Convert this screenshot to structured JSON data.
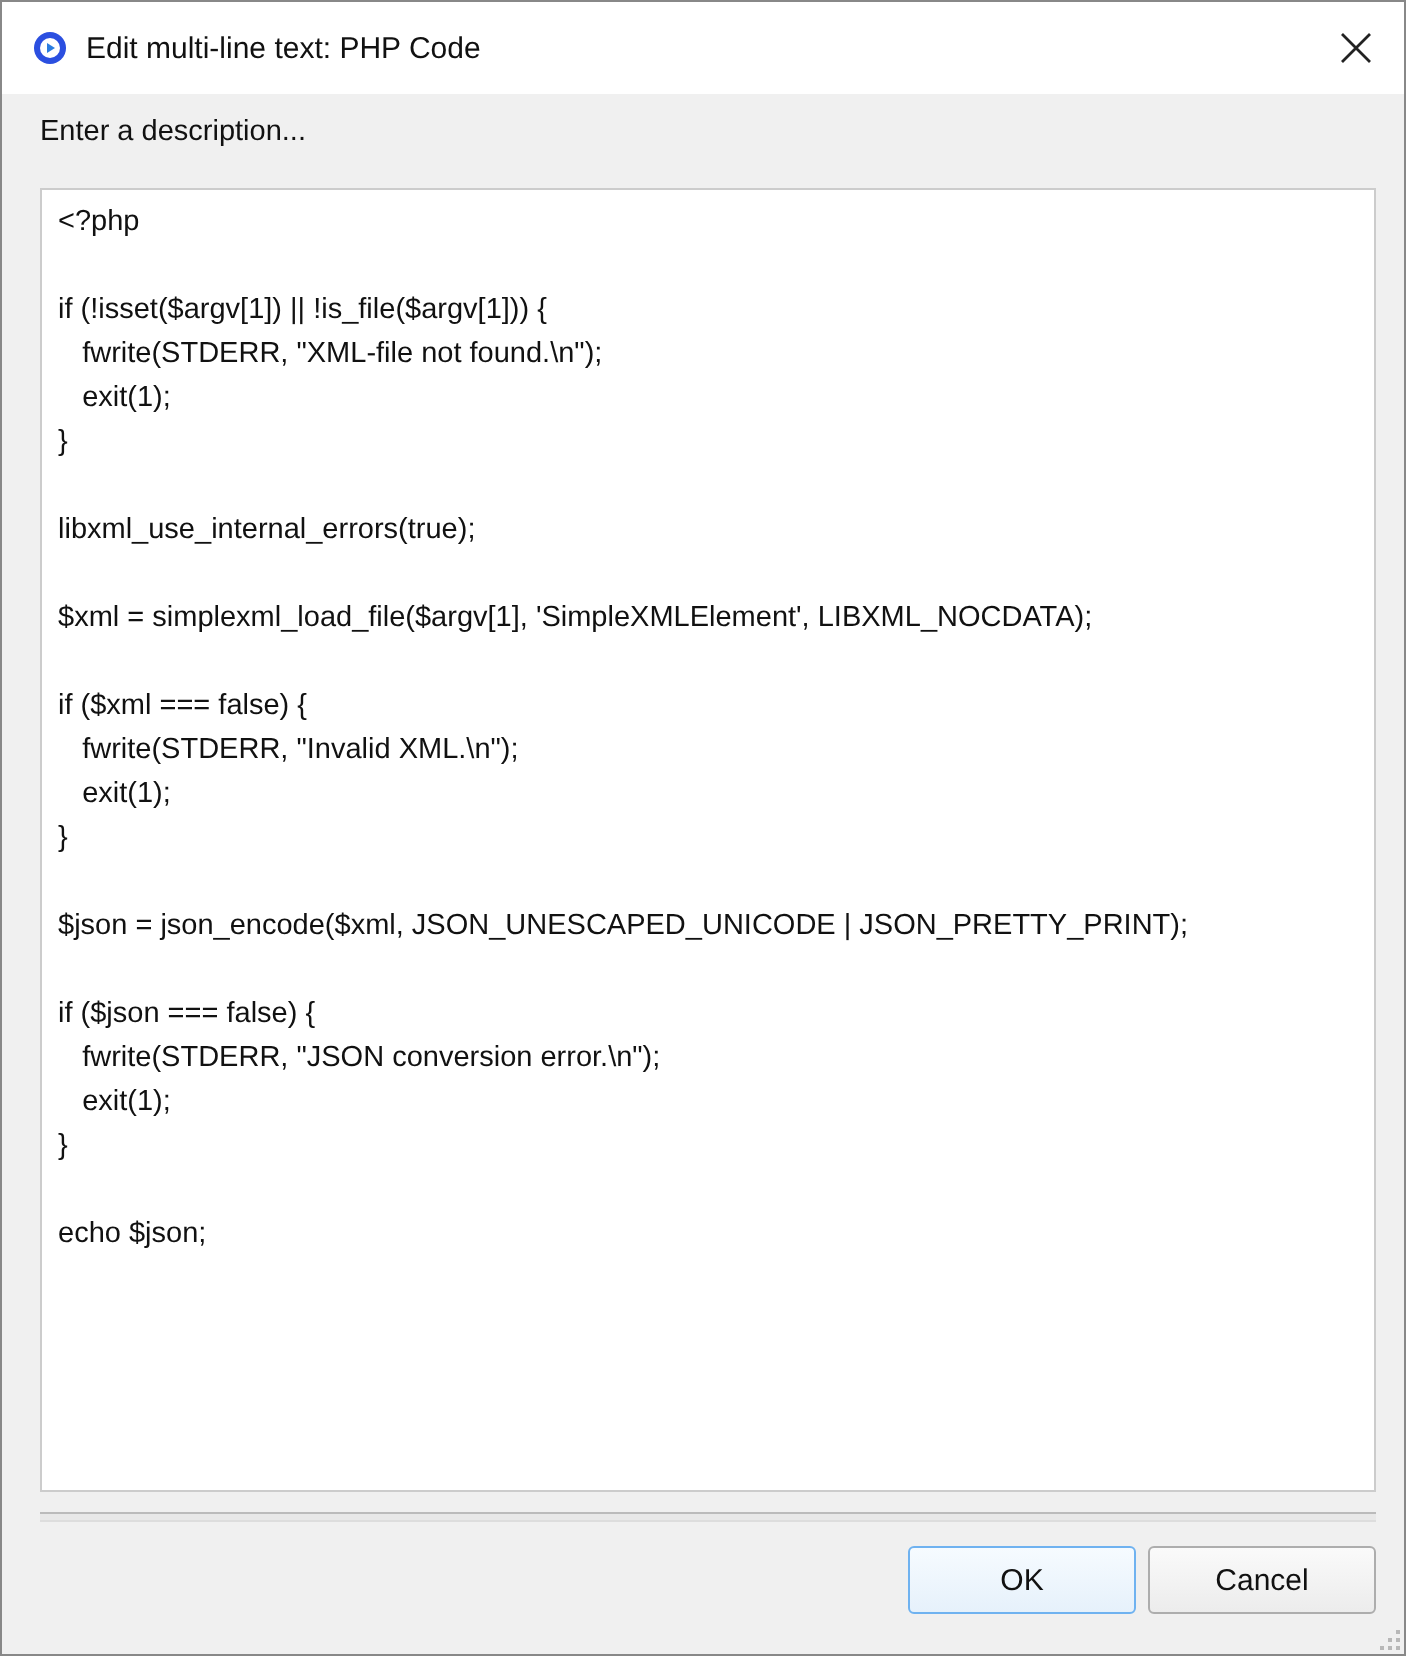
{
  "window": {
    "title": "Edit multi-line text: PHP Code"
  },
  "label": "Enter a description...",
  "editor": {
    "value": "<?php\n\nif (!isset($argv[1]) || !is_file($argv[1])) {\n   fwrite(STDERR, \"XML-file not found.\\n\");\n   exit(1);\n}\n\nlibxml_use_internal_errors(true);\n\n$xml = simplexml_load_file($argv[1], 'SimpleXMLElement', LIBXML_NOCDATA);\n\nif ($xml === false) {\n   fwrite(STDERR, \"Invalid XML.\\n\");\n   exit(1);\n}\n\n$json = json_encode($xml, JSON_UNESCAPED_UNICODE | JSON_PRETTY_PRINT);\n\nif ($json === false) {\n   fwrite(STDERR, \"JSON conversion error.\\n\");\n   exit(1);\n}\n\necho $json;"
  },
  "buttons": [
    {
      "label": "OK",
      "focused": true
    },
    {
      "label": "Cancel",
      "focused": false
    }
  ]
}
